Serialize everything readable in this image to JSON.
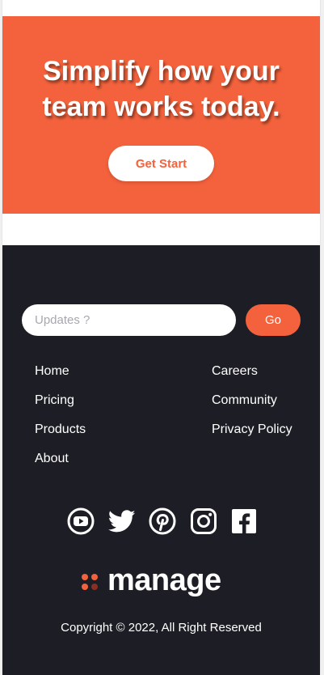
{
  "cta": {
    "title_line1": "Simplify how your",
    "title_line2": "team works today.",
    "button_label": "Get Start"
  },
  "newsletter": {
    "placeholder": "Updates ?",
    "value": "",
    "button_label": "Go"
  },
  "footer_links": {
    "left": [
      "Home",
      "Pricing",
      "Products",
      "About"
    ],
    "right": [
      "Careers",
      "Community",
      "Privacy Policy"
    ]
  },
  "social_icons": [
    "youtube-icon",
    "twitter-icon",
    "pinterest-icon",
    "instagram-icon",
    "facebook-icon"
  ],
  "brand": {
    "logo_text": "manage"
  },
  "copyright": "Copyright © 2022, All Right Reserved",
  "colors": {
    "accent": "#f3623c",
    "footer_bg": "#1d1e25",
    "white": "#ffffff"
  }
}
